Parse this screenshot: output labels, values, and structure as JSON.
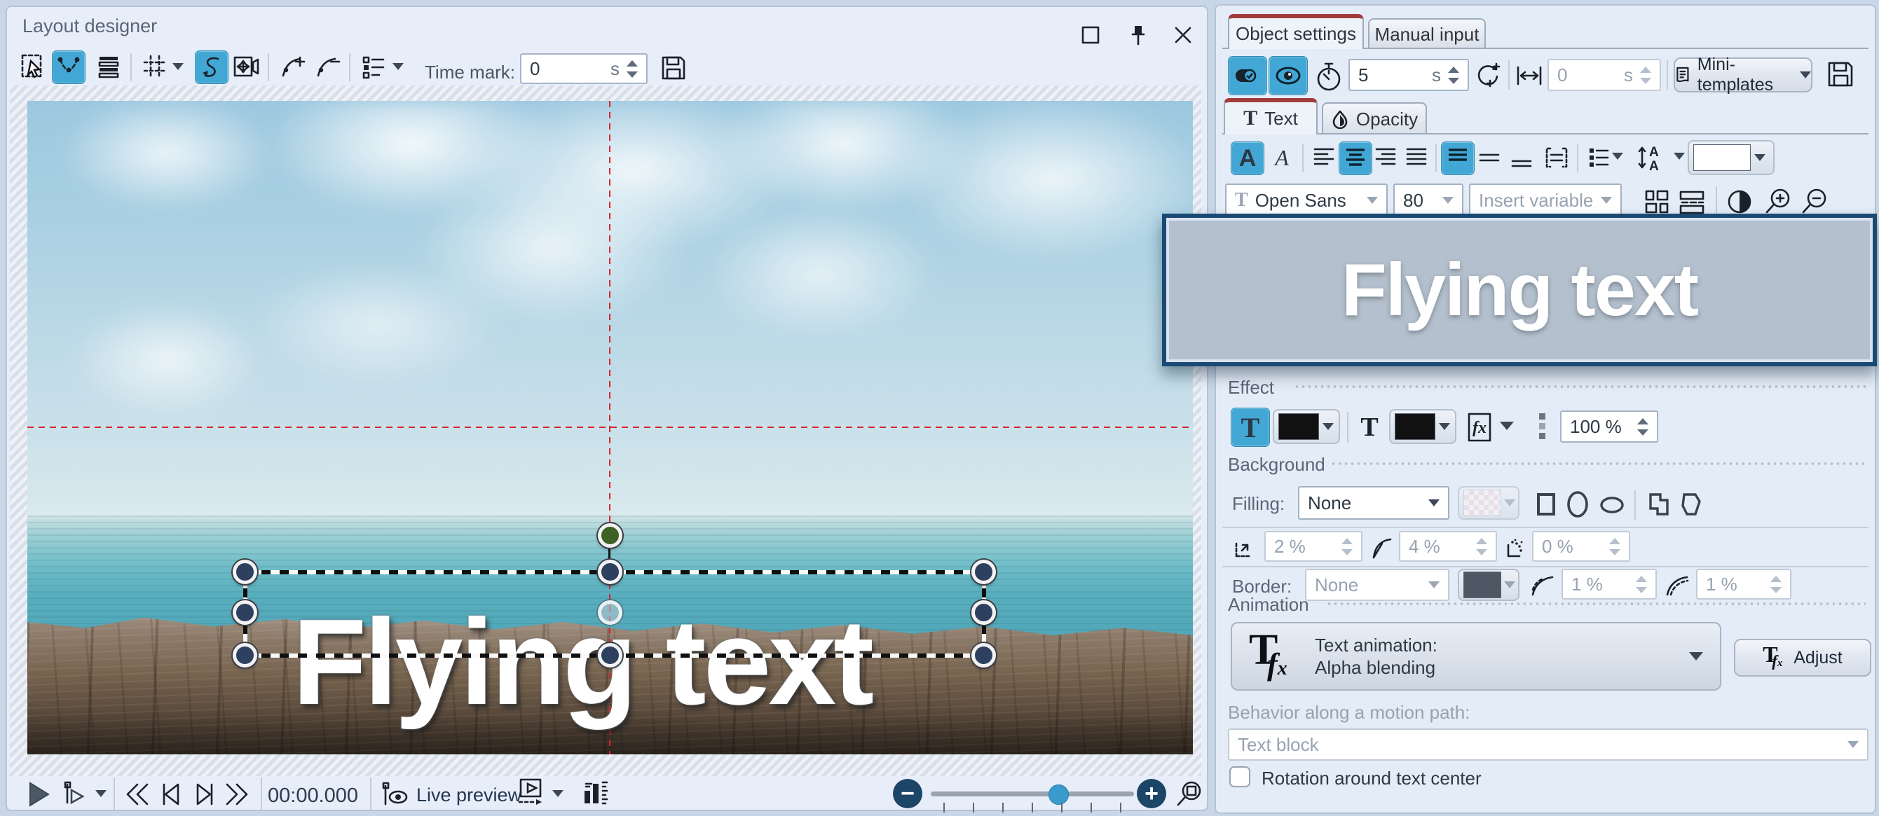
{
  "window": {
    "title": "Layout designer"
  },
  "glyphs": {
    "A": "A",
    "T": "T",
    "fx": "fx",
    "plus": "+",
    "minus": "−"
  },
  "left": {
    "toolbar": {
      "time_mark_label": "Time mark:",
      "time_mark_value": "0",
      "time_mark_unit": "s"
    },
    "canvas": {
      "overlay_text": "Flying text"
    },
    "transport": {
      "time_display": "00:00.000",
      "live_preview_label": "Live preview"
    }
  },
  "right": {
    "tabs": {
      "object_settings": "Object settings",
      "manual_input": "Manual input"
    },
    "toolbar": {
      "duration_value": "5",
      "duration_unit": "s",
      "offset_value": "0",
      "offset_unit": "s",
      "mini_templates_label": "Mini-templates"
    },
    "subtabs": {
      "text": "Text",
      "opacity": "Opacity"
    },
    "format": {
      "font_name": "Open Sans",
      "font_size": "80",
      "insert_variable_placeholder": "Insert variable"
    },
    "editor": {
      "text": "Flying text"
    },
    "effect": {
      "header": "Effect",
      "opacity_value": "100 %"
    },
    "background": {
      "header": "Background",
      "filling_label": "Filling:",
      "filling_value": "None",
      "padding_value": "2 %",
      "corner_value": "4 %",
      "blur_value": "0 %",
      "border_label": "Border:",
      "border_value": "None",
      "border_width_value": "1 %",
      "border_radius_value": "1 %"
    },
    "animation": {
      "header": "Animation",
      "dropdown_line1": "Text animation:",
      "dropdown_line2": "Alpha blending",
      "adjust_label": "Adjust",
      "behavior_label": "Behavior along a motion path:",
      "behavior_value": "Text block",
      "rotation_checkbox_label": "Rotation around text center"
    }
  },
  "colors": {
    "accent": "#42a7d4",
    "tab_marker_red": "#a23c3c",
    "editor_border": "#1a4a74",
    "handle_navy": "#2d4060",
    "handle_green": "#3f6123",
    "guide_red": "#d8242e",
    "text_white": "#ffffff",
    "swatch_black": "#111111",
    "swatch_border_gray": "#4e5763"
  }
}
